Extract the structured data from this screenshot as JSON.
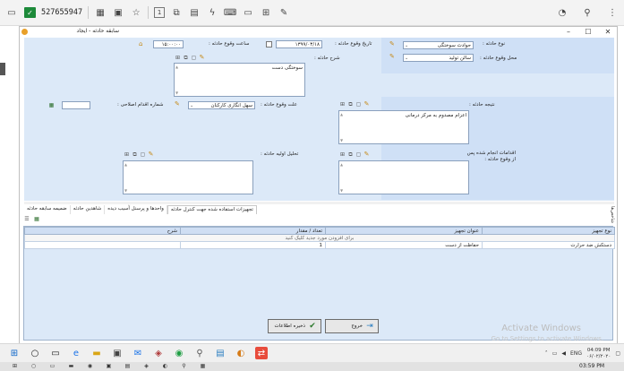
{
  "remote_toolbar": {
    "session_id": "527655947",
    "icons": [
      "monitor-icon",
      "shield-check-icon",
      "grid-icon",
      "save-icon",
      "star-icon",
      "fullscreen-icon",
      "window-icon",
      "chat-icon",
      "lightning-icon",
      "keyboard-icon",
      "screen-icon",
      "network-icon",
      "pen-icon"
    ],
    "right_icons": [
      "history-icon",
      "pin-icon",
      "menu-icon"
    ]
  },
  "window": {
    "title": "سابقه حادثه - ایجاد",
    "controls": {
      "minimize": "–",
      "maximize": "☐",
      "close": "✕"
    }
  },
  "form": {
    "incident_type": {
      "label": "نوع حادثه :",
      "value": "حوادث سوختگی"
    },
    "incident_date": {
      "label": "تاریخ وقوع حادثه :",
      "value": "۱۳۹۹/۰۳/۱۸"
    },
    "incident_time": {
      "label": "ساعت وقوع حادثه :",
      "value": "۱۵:۰۰:۰۰"
    },
    "incident_place": {
      "label": "محل وقوع حادثه :",
      "value": "سالن تولید"
    },
    "incident_description": {
      "label": "شرح حادثه :",
      "value": "سوختگی دست"
    },
    "incident_cause": {
      "label": "علت وقوع حادثه :",
      "value": "سهل انگاری کارکنان"
    },
    "corrective_action_number": {
      "label": "شماره اقدام اصلاحی :",
      "value": ""
    },
    "incident_result": {
      "label": "نتیجه حادثه :",
      "value": "اعزام مصدوم به مرکز درمانی"
    },
    "incident_analysis": {
      "label": "تحلیل اولیه حادثه :",
      "value": ""
    },
    "actions_after": {
      "label": "اقدامات انجام شده پس از وقوع حادثه :",
      "value": ""
    }
  },
  "tabs": [
    {
      "label": "تجهیزات استفاده شده جهت کنترل حادثه",
      "active": true
    },
    {
      "label": "واحدها و پرسنل آسیب دیده",
      "active": false
    },
    {
      "label": "شاهدین حادثه",
      "active": false
    },
    {
      "label": "ضمیمه سابقه حادثه",
      "active": false
    }
  ],
  "side_tab": {
    "label": "شاخص‌ها"
  },
  "grid": {
    "columns": [
      "نوع تجهیز",
      "عنوان تجهیز",
      "تعداد / مقدار",
      "شرح"
    ],
    "hint": "برای افزودن مورد جدید کلیک کنید",
    "rows": [
      {
        "type": "دستکش ضد حرارت",
        "title": "حفاظت از دست",
        "qty": "1",
        "desc": ""
      }
    ]
  },
  "buttons": {
    "save": "ذخیره اطلاعات",
    "exit": "خروج"
  },
  "watermark": {
    "line1": "Activate Windows",
    "line2": "Go to Settings to activate Windows."
  },
  "taskbar": {
    "apps": [
      "start-icon",
      "search-icon",
      "task-view-icon",
      "edge-icon",
      "file-explorer-icon",
      "store-icon",
      "mail-icon",
      "sql-icon",
      "chrome-icon",
      "search-app-icon",
      "tools-icon",
      "app-icon",
      "remote-icon"
    ],
    "language": "ENG",
    "time": "04:09 PM",
    "date": "۰۶/۰۲/۲۰۲۰"
  },
  "taskbar2": {
    "time": "03:59 PM"
  },
  "colors": {
    "form_bg": "#dce9f8",
    "accent_pen": "#c68a18",
    "remote_green": "#1d8a3a"
  }
}
